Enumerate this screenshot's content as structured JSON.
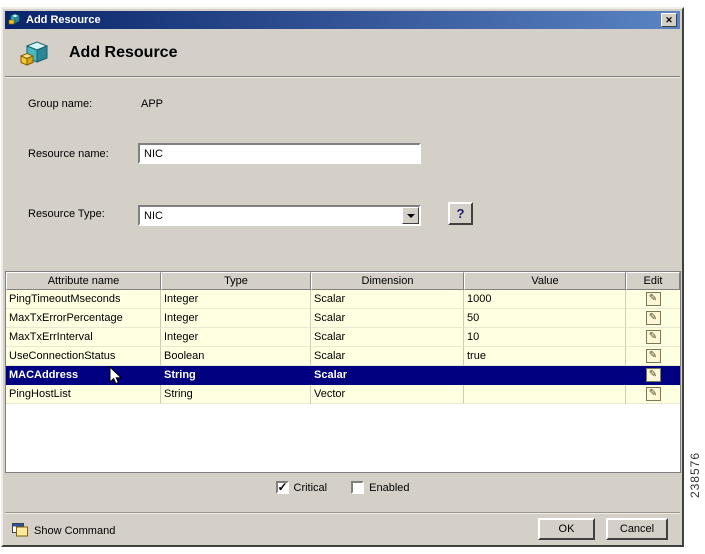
{
  "window": {
    "title": "Add Resource"
  },
  "header": {
    "title": "Add Resource"
  },
  "form": {
    "group_name": {
      "label": "Group name:",
      "value": "APP"
    },
    "resource_name": {
      "label": "Resource name:",
      "value": "NIC"
    },
    "resource_type": {
      "label": "Resource Type:",
      "value": "NIC"
    }
  },
  "table": {
    "columns": [
      "Attribute name",
      "Type",
      "Dimension",
      "Value",
      "Edit"
    ],
    "rows": [
      {
        "attribute": "PingTimeoutMseconds",
        "type": "Integer",
        "dimension": "Scalar",
        "value": "1000",
        "selected": false
      },
      {
        "attribute": "MaxTxErrorPercentage",
        "type": "Integer",
        "dimension": "Scalar",
        "value": "50",
        "selected": false
      },
      {
        "attribute": "MaxTxErrInterval",
        "type": "Integer",
        "dimension": "Scalar",
        "value": "10",
        "selected": false
      },
      {
        "attribute": "UseConnectionStatus",
        "type": "Boolean",
        "dimension": "Scalar",
        "value": "true",
        "selected": false
      },
      {
        "attribute": "MACAddress",
        "type": "String",
        "dimension": "Scalar",
        "value": "",
        "selected": true
      },
      {
        "attribute": "PingHostList",
        "type": "String",
        "dimension": "Vector",
        "value": "",
        "selected": false
      }
    ]
  },
  "options": {
    "critical": {
      "label": "Critical",
      "checked": true
    },
    "enabled": {
      "label": "Enabled",
      "checked": false
    }
  },
  "footer": {
    "show_command": "Show Command",
    "ok": "OK",
    "cancel": "Cancel"
  },
  "figure_number": "238576",
  "icons": {
    "close": "✕",
    "help": "?",
    "edit": "✎"
  },
  "colors": {
    "titlebar_start": "#0a246a",
    "titlebar_end": "#5a84c4",
    "selection": "#000080",
    "row_bg": "#ffffe1",
    "dialog_bg": "#d4d0c8"
  }
}
